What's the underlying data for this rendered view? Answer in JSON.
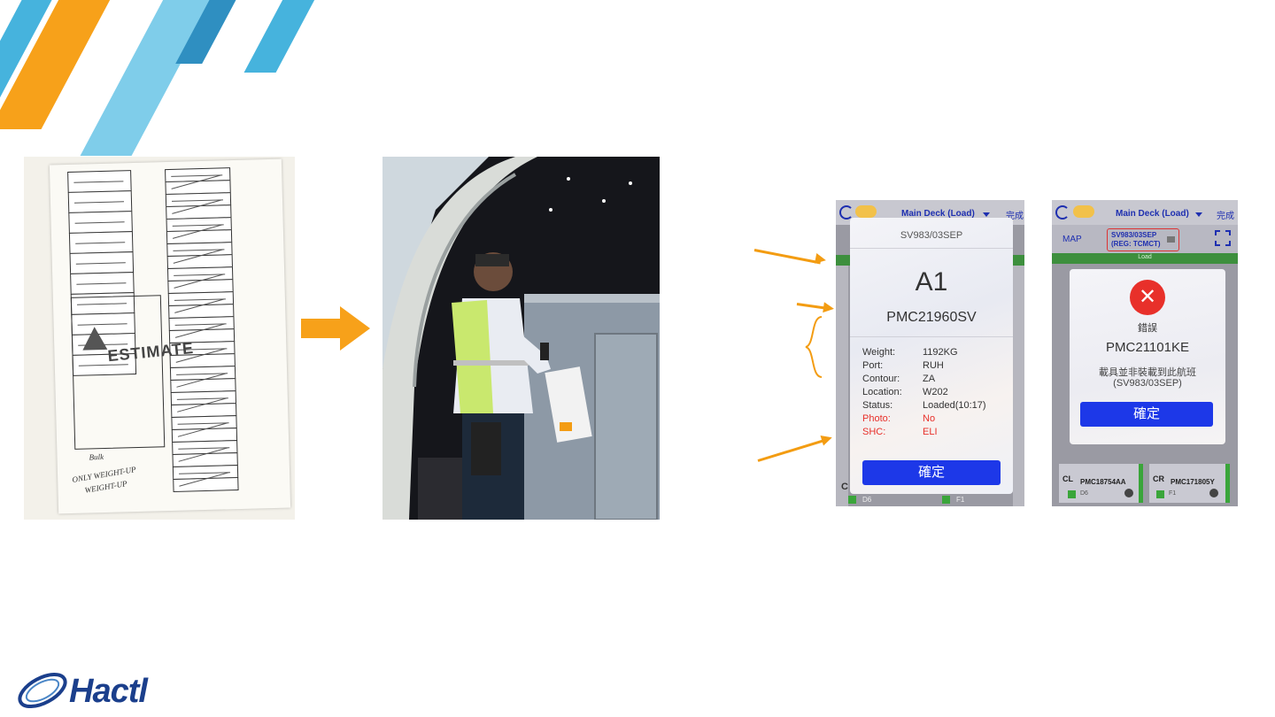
{
  "colors": {
    "orange": "#f7a11a",
    "blue_dark": "#2f8fc1",
    "blue_mid": "#46b3dd",
    "blue_light": "#7fcdea",
    "app_blue": "#1d38e8",
    "error_red": "#e8302a",
    "brand_navy": "#1b3f8c"
  },
  "paper_sheet": {
    "stamp_text": "ESTIMATE",
    "handwriting_1": "Bulk",
    "handwriting_2": "ONLY WEIGHT-UP",
    "handwriting_3": "WEIGHT-UP"
  },
  "phone1": {
    "top_bar_title": "Main Deck (Load)",
    "top_bar_action": "完成",
    "dialog_header": "SV983/03SEP",
    "position": "A1",
    "uld_id": "PMC21960SV",
    "rows": [
      {
        "label": "Weight:",
        "value": "1192KG",
        "alert": false
      },
      {
        "label": "Port:",
        "value": "RUH",
        "alert": false
      },
      {
        "label": "Contour:",
        "value": "ZA",
        "alert": false
      },
      {
        "label": "Location:",
        "value": "W202",
        "alert": false
      },
      {
        "label": "Status:",
        "value": "Loaded(10:17)",
        "alert": false
      },
      {
        "label": "Photo:",
        "value": "No",
        "alert": true
      },
      {
        "label": "SHC:",
        "value": "ELI",
        "alert": true
      }
    ],
    "confirm_label": "確定",
    "bottom_left": "C",
    "bottom_code_1": "D6",
    "bottom_code_2": "F1"
  },
  "phone2": {
    "top_bar_title": "Main Deck (Load)",
    "top_bar_action": "完成",
    "map_label": "MAP",
    "flight_line1": "SV983/03SEP",
    "flight_line2": "(REG: TCMCT)",
    "green_bar_label": "Load",
    "error_title": "錯誤",
    "error_uld": "PMC21101KE",
    "error_message": "載具並非裝載到此航班",
    "error_flight": "(SV983/03SEP)",
    "confirm_label": "確定",
    "card_left_tag": "CL",
    "card_left_uld": "PMC18754AA",
    "card_left_code": "D6",
    "card_right_tag": "CR",
    "card_right_uld": "PMC171805Y",
    "card_right_code": "F1"
  },
  "brand": {
    "name": "Hactl"
  },
  "icons": {
    "refresh": "refresh-icon",
    "app_logo": "app-logo-icon",
    "dropdown": "chevron-down-icon",
    "error": "error-x-icon",
    "scan": "scan-icon",
    "mail": "mail-icon",
    "checkbox": "checkbox-icon",
    "info": "info-icon"
  }
}
